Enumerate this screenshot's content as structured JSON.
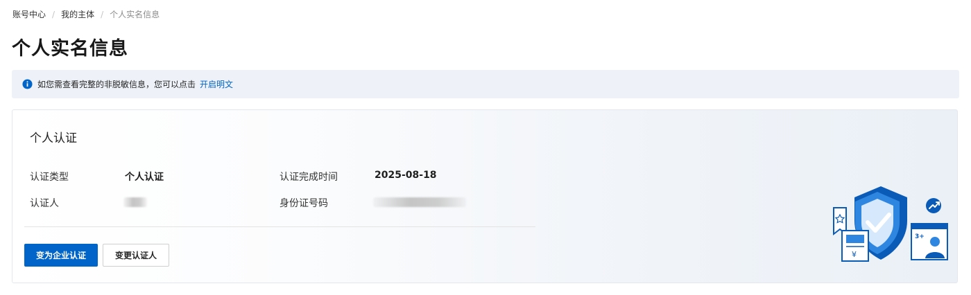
{
  "breadcrumb": {
    "items": [
      "账号中心",
      "我的主体"
    ],
    "current": "个人实名信息"
  },
  "page_title": "个人实名信息",
  "notice": {
    "text": "如您需查看完整的非脱敏信息，您可以点击",
    "link": "开启明文"
  },
  "card": {
    "title": "个人认证",
    "fields": {
      "auth_type_label": "认证类型",
      "auth_type_value": "个人认证",
      "auth_time_label": "认证完成时间",
      "auth_time_value": "2025-08-18",
      "auth_person_label": "认证人",
      "id_number_label": "身份证号码"
    },
    "buttons": {
      "primary": "变为企业认证",
      "secondary": "变更认证人"
    }
  },
  "colors": {
    "accent": "#0064c8",
    "notice_bg": "#eef2f8"
  },
  "icons": [
    "info-icon",
    "security-shield-illustration"
  ]
}
